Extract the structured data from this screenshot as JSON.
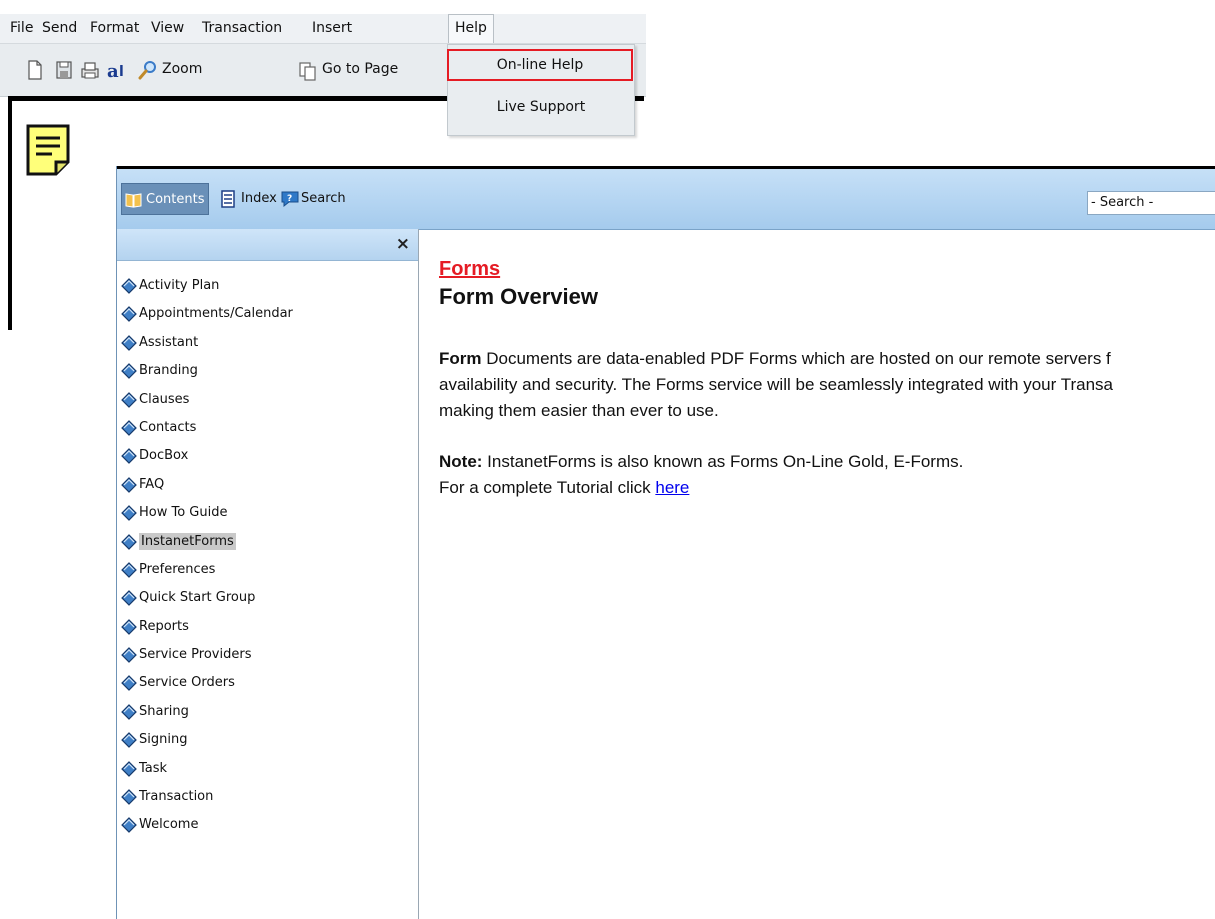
{
  "menubar": {
    "items": [
      "File",
      "Send",
      "Format",
      "View",
      "Transaction",
      "Insert",
      "Help"
    ]
  },
  "toolbar": {
    "zoom_label": "Zoom",
    "goto_label": "Go to Page",
    "icons": [
      "new-doc-icon",
      "save-icon",
      "print-icon",
      "spellcheck-icon",
      "zoom-icon",
      "go-to-page-icon"
    ]
  },
  "help_menu": {
    "online_help": "On-line Help",
    "live_support": "Live Support",
    "highlight_color": "#e51b24"
  },
  "help_window": {
    "tabs": {
      "contents": "Contents",
      "index": "Index",
      "search": "Search"
    },
    "search_placeholder": "- Search -",
    "close_symbol": "×",
    "toc": [
      "Activity Plan",
      "Appointments/Calendar",
      "Assistant",
      "Branding",
      "Clauses",
      "Contacts",
      "DocBox",
      "FAQ",
      "How To Guide",
      "InstanetForms",
      "Preferences",
      "Quick Start Group",
      "Reports",
      "Service Providers",
      "Service Orders",
      "Sharing",
      "Signing",
      "Task",
      "Transaction",
      "Welcome"
    ],
    "selected_toc": "InstanetForms"
  },
  "topic": {
    "section_link": "Forms",
    "title": "Form Overview",
    "body_bold": "Form",
    "body_line1": " Documents are data-enabled PDF Forms which are hosted on our remote servers f",
    "body_line2": "availability and security. The Forms service will be seamlessly integrated with your Transa",
    "body_line3": "making them easier than ever to use.",
    "note_bold": "Note:",
    "note_text": " InstanetForms is also known as Forms On-Line Gold, E-Forms.",
    "tutorial_text": "For a complete Tutorial click ",
    "tutorial_link": "here"
  },
  "colors": {
    "accent_red": "#e51b24",
    "toolbar_blue": "#a5cbed",
    "active_tab": "#6a90b8",
    "link_blue": "#0000ee"
  }
}
